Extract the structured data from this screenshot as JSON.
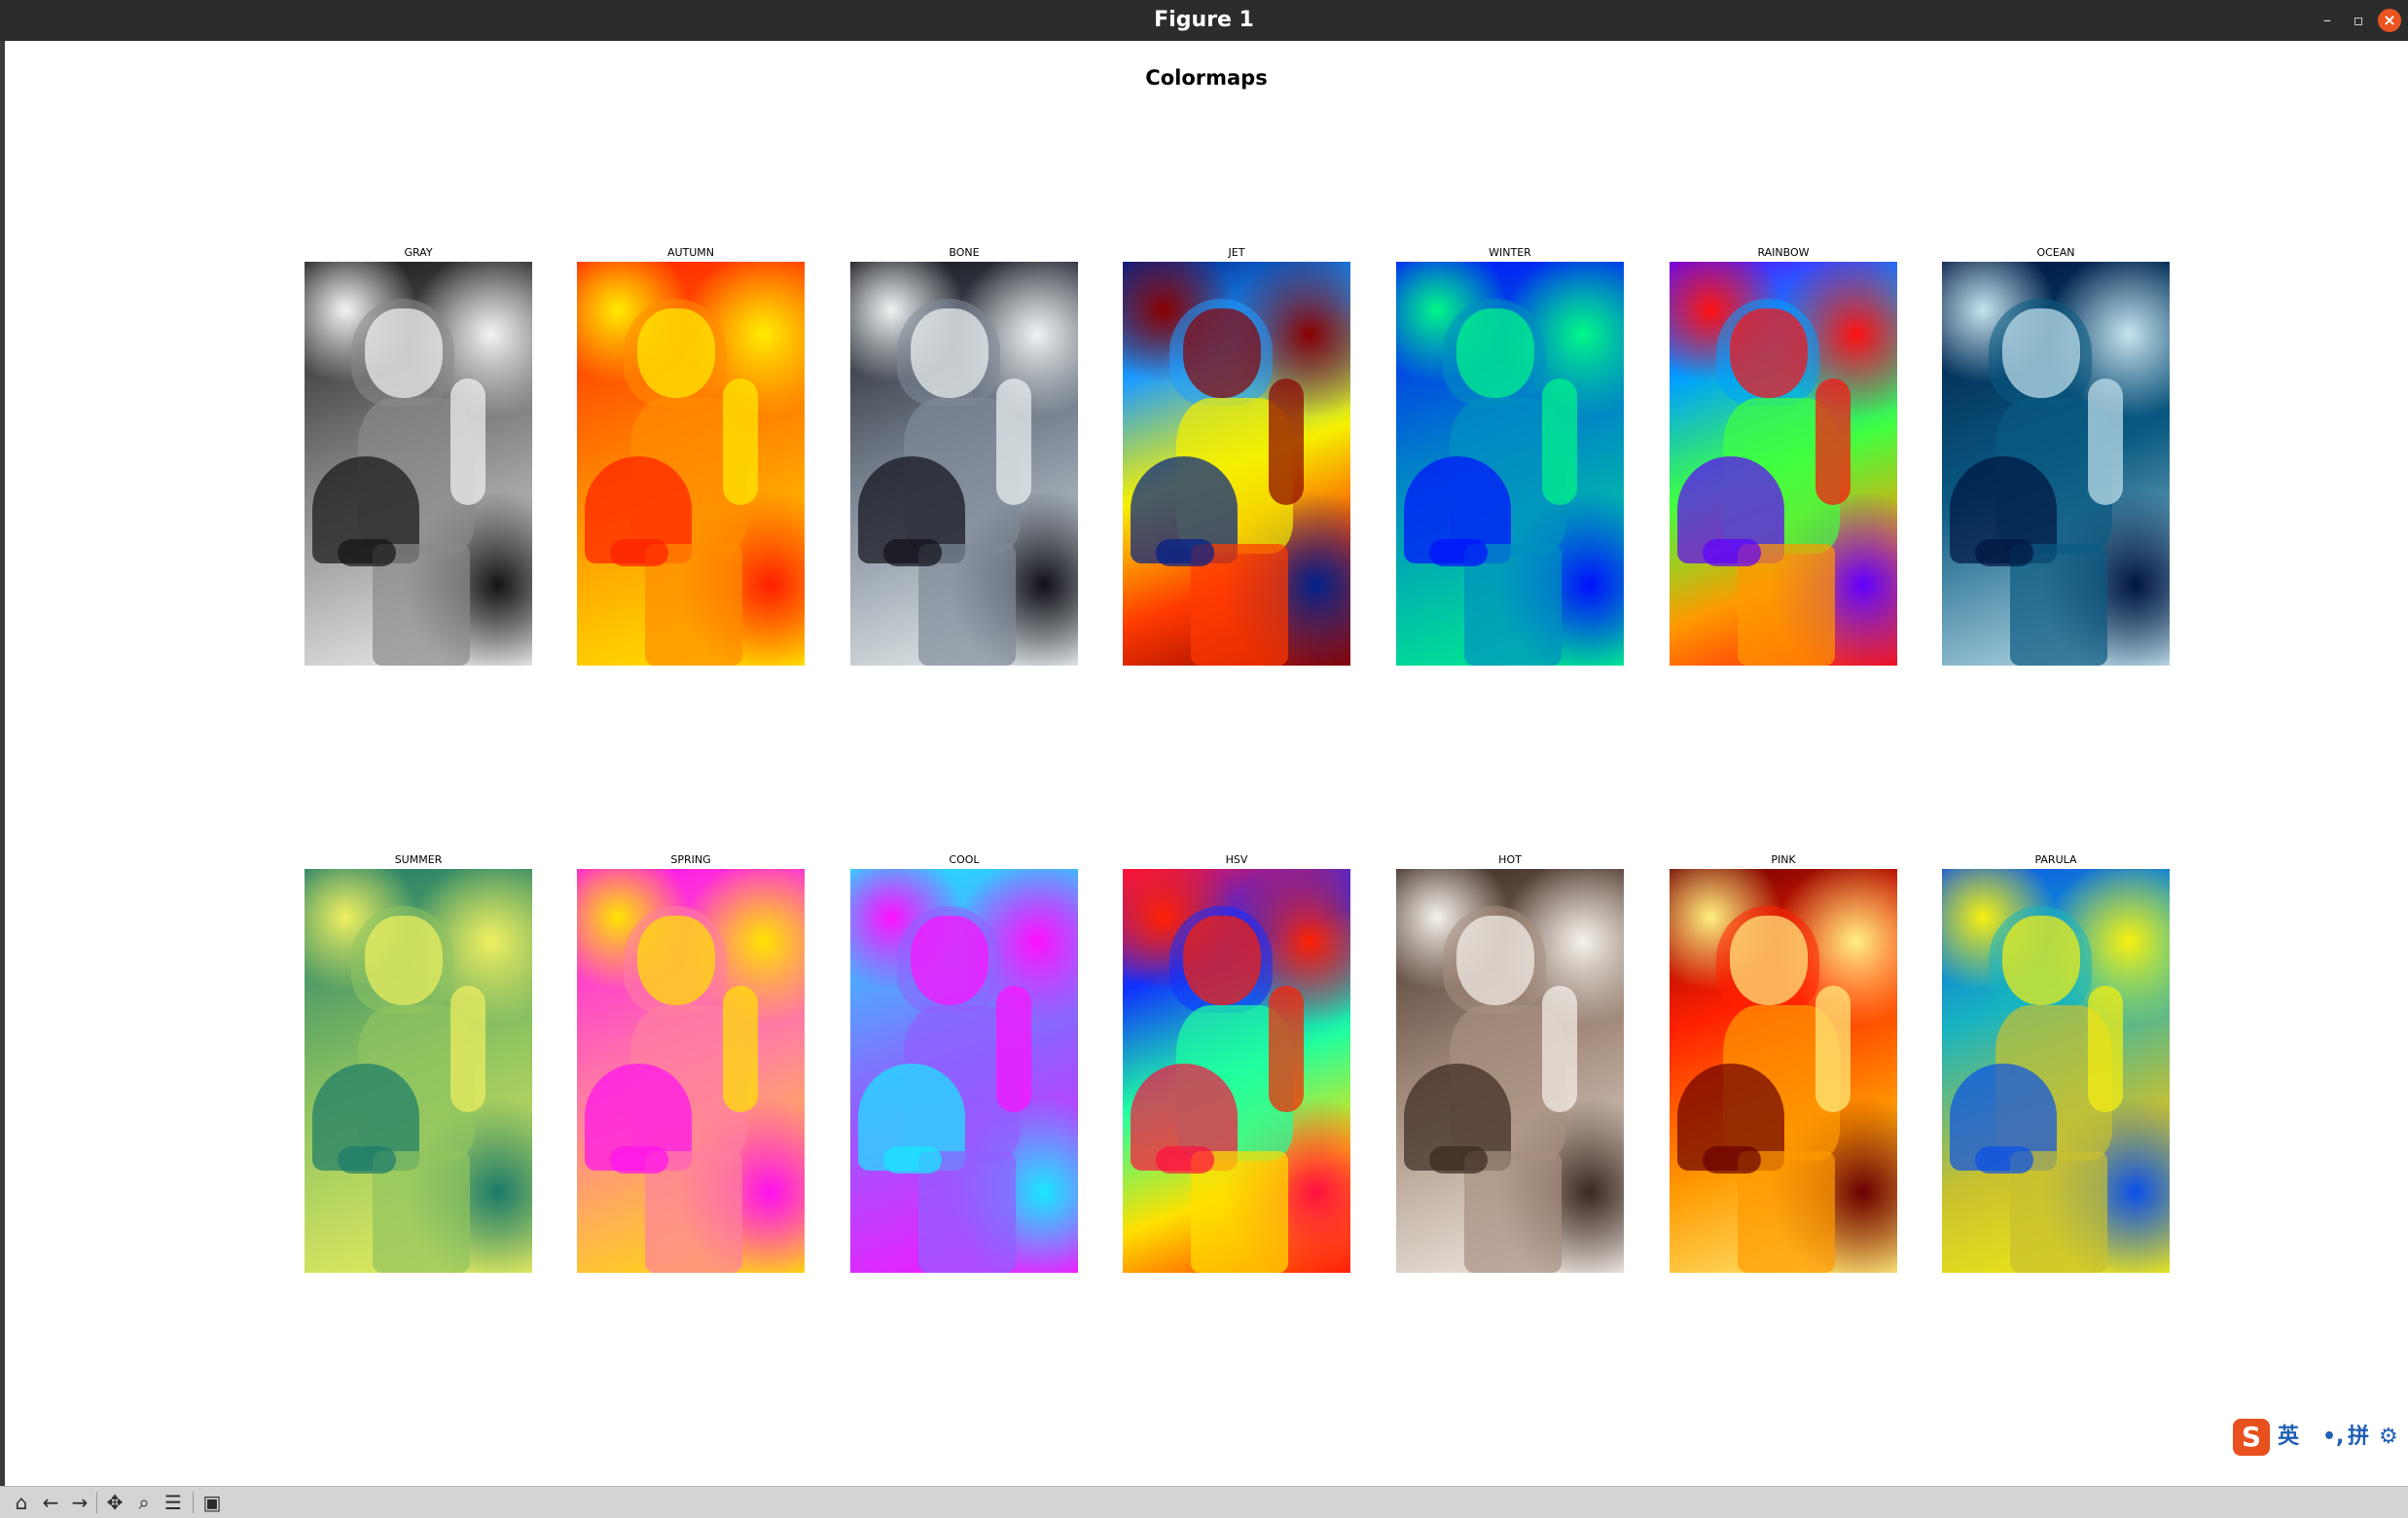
{
  "window": {
    "title": "Figure 1",
    "controls": {
      "minimize": "–",
      "maximize": "▫",
      "close": "×"
    }
  },
  "figure": {
    "suptitle": "Colormaps",
    "panels": [
      {
        "title": "GRAY",
        "colormap": "gray",
        "colors": [
          "#141414",
          "#8a8a8a",
          "#f4f4f4"
        ]
      },
      {
        "title": "AUTUMN",
        "colormap": "autumn",
        "colors": [
          "#ff1e00",
          "#ff8c00",
          "#ffec00"
        ]
      },
      {
        "title": "BONE",
        "colormap": "bone",
        "colors": [
          "#101018",
          "#7f8a98",
          "#eef4f4"
        ]
      },
      {
        "title": "JET",
        "colormap": "jet",
        "colors": [
          "#00208a",
          "#1e9cff",
          "#f5f000",
          "#ff3a00",
          "#8a0000"
        ]
      },
      {
        "title": "WINTER",
        "colormap": "winter",
        "colors": [
          "#0010ff",
          "#0090c0",
          "#00f888"
        ]
      },
      {
        "title": "RAINBOW",
        "colormap": "rainbow",
        "colors": [
          "#6000ff",
          "#00a0ff",
          "#40ff40",
          "#ff9a00",
          "#ff1010"
        ]
      },
      {
        "title": "OCEAN",
        "colormap": "ocean",
        "colors": [
          "#001540",
          "#0a5a82",
          "#c6e4ee"
        ]
      },
      {
        "title": "SUMMER",
        "colormap": "summer",
        "colors": [
          "#1a7a6a",
          "#90c460",
          "#f0f060"
        ]
      },
      {
        "title": "SPRING",
        "colormap": "spring",
        "colors": [
          "#ff10f0",
          "#ff80a0",
          "#ffe400"
        ]
      },
      {
        "title": "COOL",
        "colormap": "cool",
        "colors": [
          "#18e8ff",
          "#9060ff",
          "#ff10ff"
        ]
      },
      {
        "title": "HSV",
        "colormap": "hsv",
        "colors": [
          "#ff1040",
          "#1030ff",
          "#20ffa0",
          "#ffe000",
          "#ff2000"
        ]
      },
      {
        "title": "HOT",
        "colormap": "hot",
        "colors": [
          "#3a2820",
          "#a89080",
          "#f6f2ec"
        ]
      },
      {
        "title": "PINK",
        "colormap": "pink",
        "colors": [
          "#6a0000",
          "#ff2000",
          "#ff9a00",
          "#fff080"
        ]
      },
      {
        "title": "PARULA",
        "colormap": "parula",
        "colors": [
          "#0a50e8",
          "#18b4c0",
          "#c8c030",
          "#f8f010"
        ]
      }
    ]
  },
  "toolbar": {
    "icons": [
      "home-icon",
      "back-arrow-icon",
      "forward-arrow-icon",
      "pan-icon",
      "zoom-icon",
      "subplots-config-icon",
      "save-icon"
    ]
  },
  "ime": {
    "logo": "S",
    "lang": "英",
    "punct": "•,",
    "mode": "拼",
    "settings": "⚙"
  }
}
